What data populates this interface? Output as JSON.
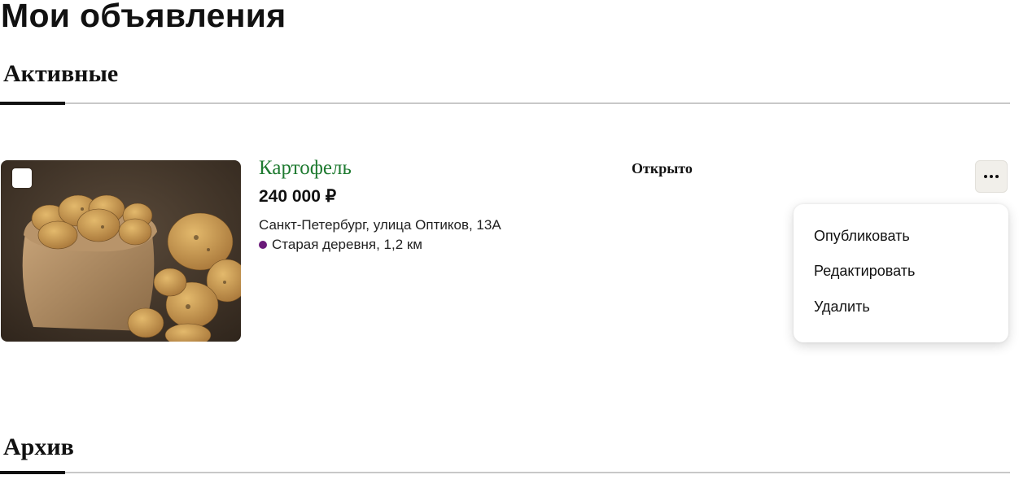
{
  "page": {
    "title": "Мои объявления"
  },
  "sections": {
    "active": {
      "title": "Активные"
    },
    "archive": {
      "title": "Архив"
    }
  },
  "listing": {
    "title": "Картофель",
    "price": "240 000 ₽",
    "address": "Санкт-Петербург, улица Оптиков, 13А",
    "metro": "Старая деревня, 1,2 км",
    "metro_color": "#6b1a7a",
    "status": "Открыто",
    "title_color": "#1e7a30",
    "image_icon": "potato-sack-photo"
  },
  "menu": {
    "button_icon": "more-dots-icon",
    "items": [
      {
        "label": "Опубликовать"
      },
      {
        "label": "Редактировать"
      },
      {
        "label": "Удалить"
      }
    ]
  }
}
